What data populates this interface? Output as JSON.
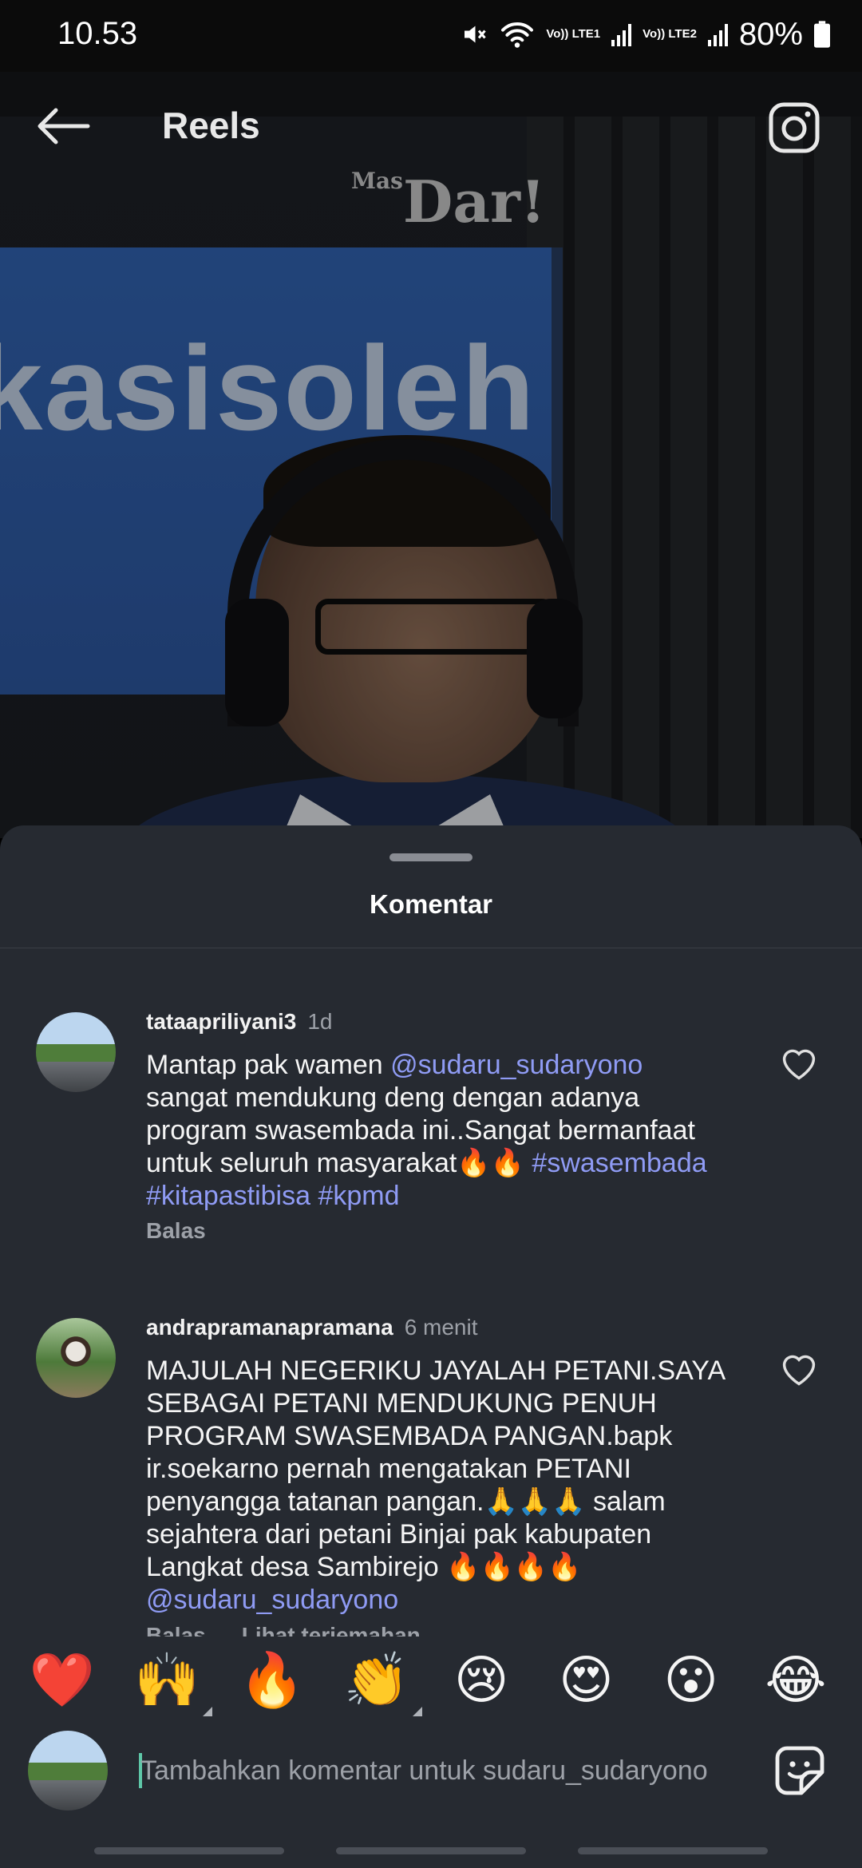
{
  "status_bar": {
    "time": "10.53",
    "battery_percent": "80%",
    "sim1_label": "Vo)) LTE1",
    "sim2_label": "Vo)) LTE2",
    "icons": [
      "mute-icon",
      "wifi-icon",
      "signal-icon",
      "battery-icon"
    ]
  },
  "video": {
    "watermark_prefix": "Mas",
    "watermark_text": "Dar!",
    "board_text": "kasisoleh"
  },
  "header": {
    "title": "Reels",
    "back_icon": "arrow-left-icon",
    "camera_icon": "camera-icon"
  },
  "sheet": {
    "title": "Komentar"
  },
  "comments": [
    {
      "username": "tataapriliyani3",
      "time": "1d",
      "text_parts": [
        {
          "t": "Mantap pak wamen ",
          "link": false
        },
        {
          "t": "@sudaru_sudaryono",
          "link": true
        },
        {
          "t": "\nsangat mendukung deng dengan adanya\nprogram swasembada ini..Sangat bermanfaat\nuntuk seluruh masyarakat🔥🔥 ",
          "link": false
        },
        {
          "t": "#swasembada",
          "link": true
        },
        {
          "t": "\n",
          "link": false
        },
        {
          "t": "#kitapastibisa",
          "link": true
        },
        {
          "t": " ",
          "link": false
        },
        {
          "t": "#kpmd",
          "link": true
        }
      ],
      "reply_label": "Balas",
      "translate_label": ""
    },
    {
      "username": "andrapramanapramana",
      "time": "6 menit",
      "text_parts": [
        {
          "t": "MAJULAH NEGERIKU JAYALAH PETANI.SAYA\nSEBAGAI PETANI MENDUKUNG PENUH\nPROGRAM SWASEMBADA PANGAN.bapk\nir.soekarno pernah mengatakan PETANI\npenyangga tatanan pangan.🙏🙏🙏 salam\nsejahtera dari petani Binjai pak kabupaten\nLangkat desa Sambirejo 🔥🔥🔥🔥\n",
          "link": false
        },
        {
          "t": "@sudaru_sudaryono",
          "link": true
        }
      ],
      "reply_label": "Balas",
      "translate_label": "Lihat terjemahan"
    }
  ],
  "reactions": [
    {
      "emoji": "❤️",
      "name": "heart-emoji",
      "has_variants": false
    },
    {
      "emoji": "🙌",
      "name": "raising-hands-emoji",
      "has_variants": true
    },
    {
      "emoji": "🔥",
      "name": "fire-emoji",
      "has_variants": false
    },
    {
      "emoji": "👏",
      "name": "clapping-hands-emoji",
      "has_variants": true
    },
    {
      "emoji": "😢",
      "name": "crying-face-emoji",
      "has_variants": false
    },
    {
      "emoji": "😍",
      "name": "heart-eyes-emoji",
      "has_variants": false
    },
    {
      "emoji": "😮",
      "name": "surprised-face-emoji",
      "has_variants": false
    },
    {
      "emoji": "😂",
      "name": "tears-of-joy-emoji",
      "has_variants": false
    }
  ],
  "input": {
    "placeholder": "Tambahkan komentar untuk sudaru_sudaryono",
    "value": "",
    "sticker_icon": "sticker-icon"
  },
  "colors": {
    "sheet_bg": "#262a31",
    "link": "#8f9bf4",
    "muted": "#9da1a8",
    "cursor": "#5ec7a8"
  }
}
